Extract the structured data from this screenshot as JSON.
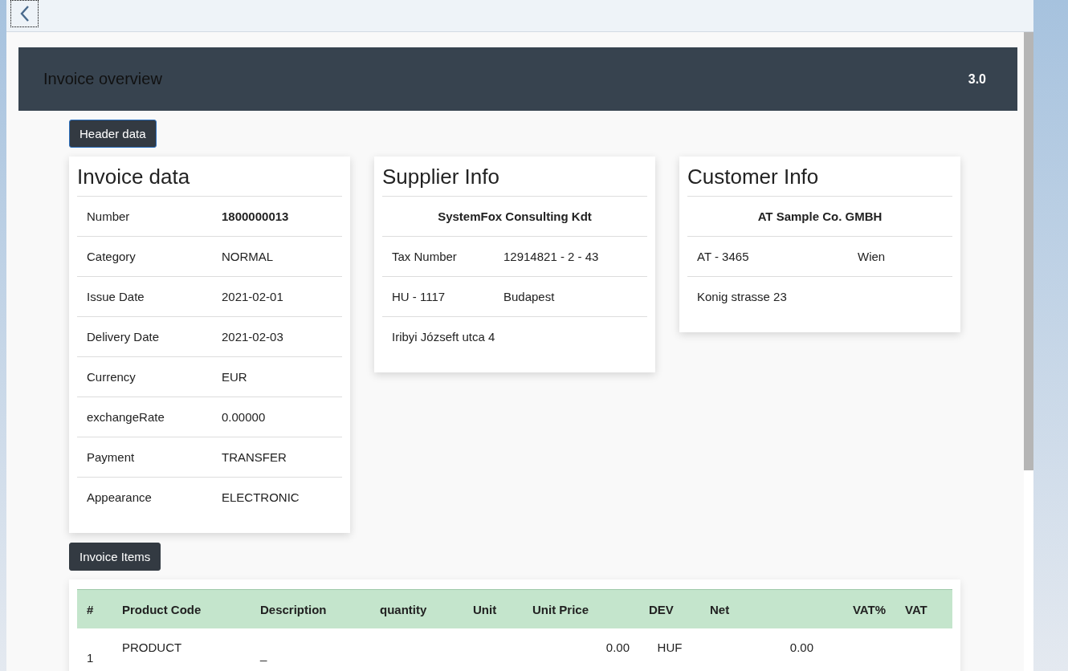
{
  "page_title": "Invoice overview",
  "version": "3.0",
  "header_button": "Header data",
  "invoice_data": {
    "title": "Invoice data",
    "fields": [
      {
        "label": "Number",
        "value": "1800000013",
        "bold": true
      },
      {
        "label": "Category",
        "value": "NORMAL",
        "bold": false
      },
      {
        "label": "Issue Date",
        "value": "2021-02-01",
        "bold": false
      },
      {
        "label": "Delivery Date",
        "value": "2021-02-03",
        "bold": false
      },
      {
        "label": "Currency",
        "value": "EUR",
        "bold": false
      },
      {
        "label": "exchangeRate",
        "value": "0.00000",
        "bold": false
      },
      {
        "label": "Payment",
        "value": "TRANSFER",
        "bold": false
      },
      {
        "label": "Appearance",
        "value": "ELECTRONIC",
        "bold": false
      }
    ]
  },
  "supplier_info": {
    "title": "Supplier Info",
    "name": "SystemFox Consulting Kdt",
    "rows": [
      [
        "Tax Number",
        "12914821 - 2 - 43"
      ],
      [
        "HU - 1117",
        "Budapest"
      ],
      [
        "Iribyi Józseft utca 4"
      ]
    ]
  },
  "customer_info": {
    "title": "Customer Info",
    "name": "AT Sample Co. GMBH",
    "rows": [
      [
        "AT - 3465",
        "Wien"
      ],
      [
        "Konig strasse 23"
      ]
    ]
  },
  "items_button": "Invoice Items",
  "items_table": {
    "columns": [
      "#",
      "Product Code",
      "Description",
      "quantity",
      "Unit",
      "Unit Price",
      "DEV",
      "Net",
      "VAT%",
      "VAT"
    ],
    "rows": [
      {
        "number": "1",
        "product_code": "PRODUCT",
        "description": "_",
        "unit_price": "0.00",
        "dev": "HUF",
        "net": "0.00"
      }
    ]
  }
}
